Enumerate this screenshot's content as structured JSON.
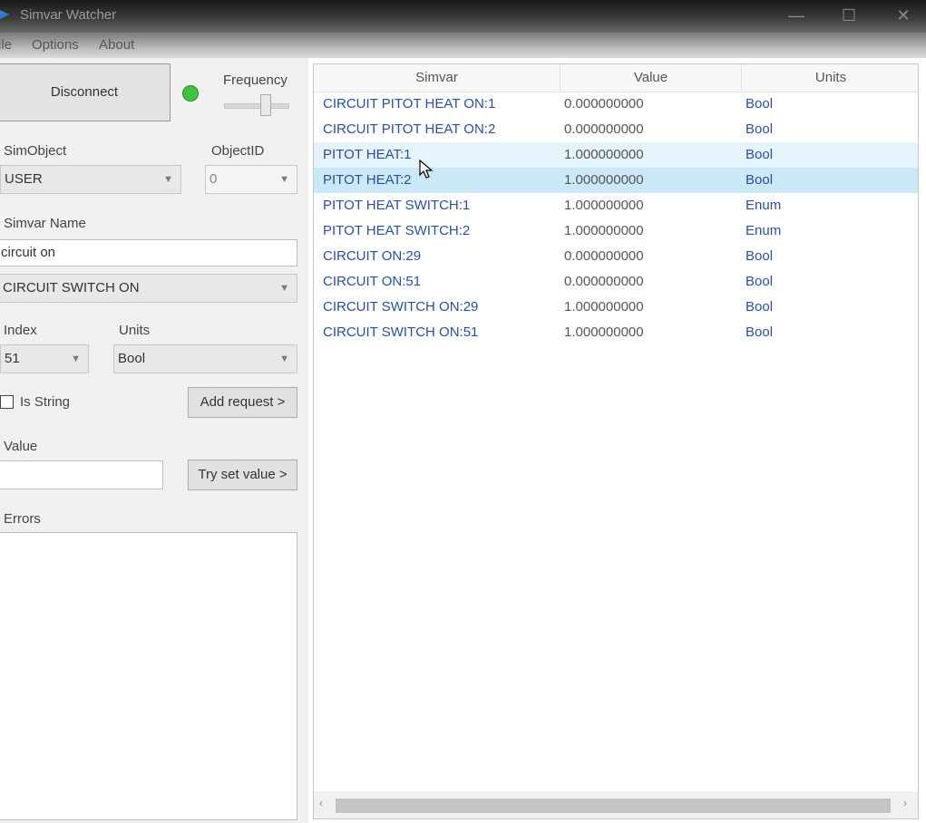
{
  "window": {
    "title": "Simvar Watcher",
    "controls": {
      "minimize": "—",
      "maximize": "☐",
      "close": "✕"
    }
  },
  "menu": {
    "file": "ile",
    "options": "Options",
    "about": "About"
  },
  "left": {
    "disconnect_label": "Disconnect",
    "connection_status_color": "#3fc23f",
    "frequency_label": "Frequency",
    "simobject_label": "SimObject",
    "simobject_value": "USER",
    "objectid_label": "ObjectID",
    "objectid_value": "0",
    "simvar_name_label": "Simvar Name",
    "simvar_name_value": "circuit on",
    "simvar_select_value": "CIRCUIT SWITCH ON",
    "index_label": "Index",
    "index_value": "51",
    "units_label": "Units",
    "units_value": "Bool",
    "is_string_label": "Is String",
    "is_string_checked": false,
    "add_request_label": "Add request >",
    "value_label": "Value",
    "value_value": "",
    "try_set_label": "Try set value >",
    "errors_label": "Errors"
  },
  "grid": {
    "columns": [
      "Simvar",
      "Value",
      "Units"
    ],
    "rows": [
      {
        "simvar": "CIRCUIT PITOT HEAT ON:1",
        "value": "0.000000000",
        "units": "Bool",
        "state": ""
      },
      {
        "simvar": "CIRCUIT PITOT HEAT ON:2",
        "value": "0.000000000",
        "units": "Bool",
        "state": ""
      },
      {
        "simvar": "PITOT HEAT:1",
        "value": "1.000000000",
        "units": "Bool",
        "state": "hover"
      },
      {
        "simvar": "PITOT HEAT:2",
        "value": "1.000000000",
        "units": "Bool",
        "state": "selected"
      },
      {
        "simvar": "PITOT HEAT SWITCH:1",
        "value": "1.000000000",
        "units": "Enum",
        "state": ""
      },
      {
        "simvar": "PITOT HEAT SWITCH:2",
        "value": "1.000000000",
        "units": "Enum",
        "state": ""
      },
      {
        "simvar": "CIRCUIT ON:29",
        "value": "0.000000000",
        "units": "Bool",
        "state": ""
      },
      {
        "simvar": "CIRCUIT ON:51",
        "value": "0.000000000",
        "units": "Bool",
        "state": ""
      },
      {
        "simvar": "CIRCUIT SWITCH ON:29",
        "value": "1.000000000",
        "units": "Bool",
        "state": ""
      },
      {
        "simvar": "CIRCUIT SWITCH ON:51",
        "value": "1.000000000",
        "units": "Bool",
        "state": ""
      }
    ],
    "scroll_left": "‹",
    "scroll_right": "›"
  }
}
